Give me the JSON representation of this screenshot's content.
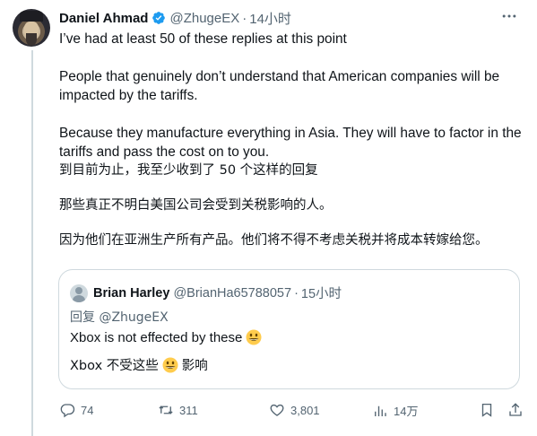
{
  "author": {
    "name": "Daniel Ahmad",
    "handle": "@ZhugeEX",
    "separator": "·",
    "time": "14小时"
  },
  "icons": {
    "verified": "verified-badge-icon",
    "more": "more-dots-icon",
    "reply": "reply-bubble-icon",
    "retweet": "retweet-icon",
    "like": "heart-icon",
    "views": "views-bar-chart-icon",
    "bookmark": "bookmark-icon",
    "share": "share-icon",
    "emoji": "grinning-face-emoji"
  },
  "colors": {
    "verified": "#1d9bf0",
    "secondary_text": "#536471",
    "border": "#cfd9de",
    "emoji_fill": "#ffcc4d"
  },
  "tweet": {
    "paragraphs": [
      "I’ve had at least 50 of these replies at this point",
      "People that genuinely don’t understand that American companies will be impacted by the tariffs.",
      "Because they manufacture everything in Asia. They will have to factor in the tariffs and pass the cost on to you."
    ],
    "translation": [
      "到目前为止，我至少收到了 50 个这样的回复",
      "那些真正不明白美国公司会受到关税影响的人。",
      "因为他们在亚洲生产所有产品。他们将不得不考虑关税并将成本转嫁给您。"
    ]
  },
  "quote": {
    "name": "Brian Harley",
    "handle": "@BrianHa65788057",
    "separator": "·",
    "time": "15小时",
    "reply_prefix": "回复",
    "reply_to": "@ZhugeEX",
    "text": "Xbox is not effected by these",
    "translation_before": "Xbox 不受这些",
    "translation_after": "影响"
  },
  "actions": {
    "replies": "74",
    "retweets": "311",
    "likes": "3,801",
    "views": "14万"
  }
}
